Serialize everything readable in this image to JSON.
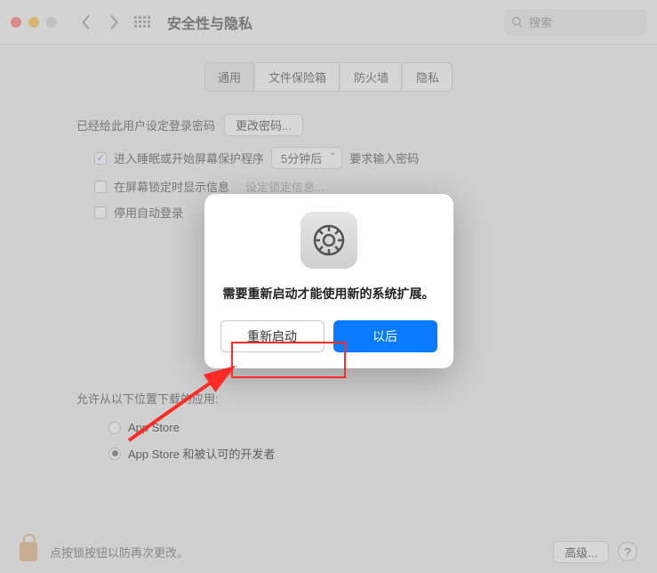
{
  "titlebar": {
    "title": "安全性与隐私",
    "search_placeholder": "搜索"
  },
  "tabs": [
    "通用",
    "文件保险箱",
    "防火墙",
    "隐私"
  ],
  "pw": {
    "set_text": "已经给此用户设定登录密码",
    "change_btn": "更改密码...",
    "c1": "进入睡眠或开始屏幕保护程序",
    "delay": "5分钟后",
    "require_after": "要求输入密码",
    "c2": "在屏幕锁定时显示信息",
    "set_lock_msg": "设定锁定信息...",
    "c3": "停用自动登录"
  },
  "download": {
    "title": "允许从以下位置下载的应用:",
    "r1": "App Store",
    "r2": "App Store 和被认可的开发者"
  },
  "modal": {
    "msg": "需要重新启动才能使用新的系统扩展。",
    "restart": "重新启动",
    "later": "以后"
  },
  "bottom": {
    "lock_text": "点按锁按钮以防再次更改。",
    "advanced": "高级..."
  }
}
